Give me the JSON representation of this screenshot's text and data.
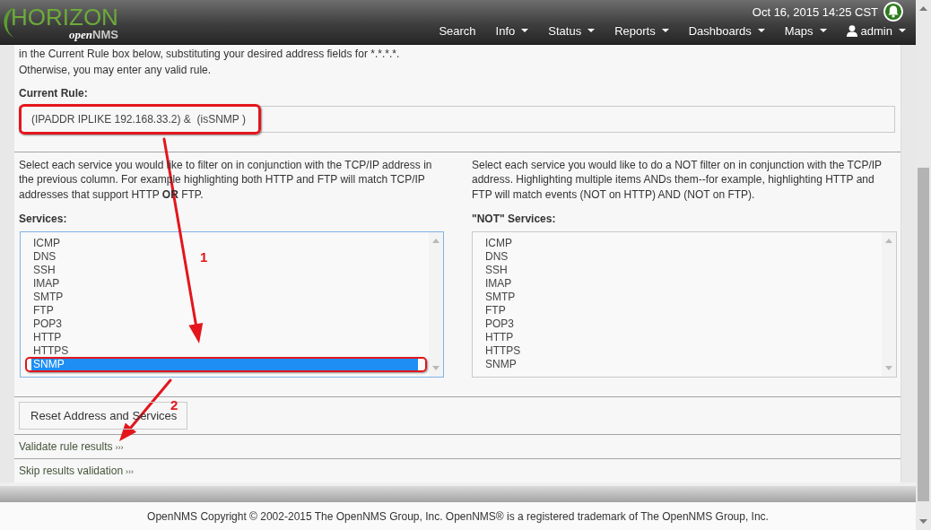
{
  "header": {
    "logo": {
      "title": "HORIZON",
      "subtitle_prefix": "open",
      "subtitle_suffix": "NMS"
    },
    "datetime": "Oct 16, 2015 14:25 CST",
    "nav": [
      {
        "label": "Search",
        "kind": "link"
      },
      {
        "label": "Info",
        "kind": "menu"
      },
      {
        "label": "Status",
        "kind": "menu"
      },
      {
        "label": "Reports",
        "kind": "menu"
      },
      {
        "label": "Dashboards",
        "kind": "menu"
      },
      {
        "label": "Maps",
        "kind": "menu"
      },
      {
        "label": "admin",
        "kind": "user"
      }
    ]
  },
  "intro": [
    "in the Current Rule box below, substituting your desired address fields for *.*.*.*.",
    "Otherwise, you may enter any valid rule."
  ],
  "current_rule": {
    "label": "Current Rule:",
    "value": "(IPADDR IPLIKE 192.168.33.2) &  (isSNMP )",
    "highlighted": true
  },
  "service_columns": [
    {
      "description": "Select each service you would like to filter on in conjunction with the TCP/IP address in the previous column. For example highlighting both HTTP and FTP will match TCP/IP addresses that support HTTP **OR** FTP.",
      "label": "Services:",
      "focused": true,
      "items": [
        {
          "name": "ICMP",
          "selected": false,
          "highlighted": false
        },
        {
          "name": "DNS",
          "selected": false,
          "highlighted": false
        },
        {
          "name": "SSH",
          "selected": false,
          "highlighted": false
        },
        {
          "name": "IMAP",
          "selected": false,
          "highlighted": false
        },
        {
          "name": "SMTP",
          "selected": false,
          "highlighted": false
        },
        {
          "name": "FTP",
          "selected": false,
          "highlighted": false
        },
        {
          "name": "POP3",
          "selected": false,
          "highlighted": false
        },
        {
          "name": "HTTP",
          "selected": false,
          "highlighted": false
        },
        {
          "name": "HTTPS",
          "selected": false,
          "highlighted": false
        },
        {
          "name": "SNMP",
          "selected": true,
          "highlighted": true
        }
      ]
    },
    {
      "description": "Select each service you would like to do a NOT filter on in conjunction with the TCP/IP address. Highlighting multiple items ANDs them--for example, highlighting HTTP and FTP will match events (NOT on HTTP) AND (NOT on FTP).",
      "label": "\"NOT\" Services:",
      "focused": false,
      "items": [
        {
          "name": "ICMP",
          "selected": false,
          "highlighted": false
        },
        {
          "name": "DNS",
          "selected": false,
          "highlighted": false
        },
        {
          "name": "SSH",
          "selected": false,
          "highlighted": false
        },
        {
          "name": "IMAP",
          "selected": false,
          "highlighted": false
        },
        {
          "name": "SMTP",
          "selected": false,
          "highlighted": false
        },
        {
          "name": "FTP",
          "selected": false,
          "highlighted": false
        },
        {
          "name": "POP3",
          "selected": false,
          "highlighted": false
        },
        {
          "name": "HTTP",
          "selected": false,
          "highlighted": false
        },
        {
          "name": "HTTPS",
          "selected": false,
          "highlighted": false
        },
        {
          "name": "SNMP",
          "selected": false,
          "highlighted": false
        }
      ]
    }
  ],
  "reset_button": {
    "label": "Reset Address and Services"
  },
  "links": [
    {
      "label": "Validate rule results",
      "suffix": "›››"
    },
    {
      "label": "Skip results validation",
      "suffix": "›››"
    }
  ],
  "callouts": [
    {
      "label": "1"
    },
    {
      "label": "2"
    }
  ],
  "footer": {
    "text": "OpenNMS Copyright © 2002-2015 The OpenNMS Group, Inc. OpenNMS® is a registered trademark of The OpenNMS Group, Inc."
  }
}
